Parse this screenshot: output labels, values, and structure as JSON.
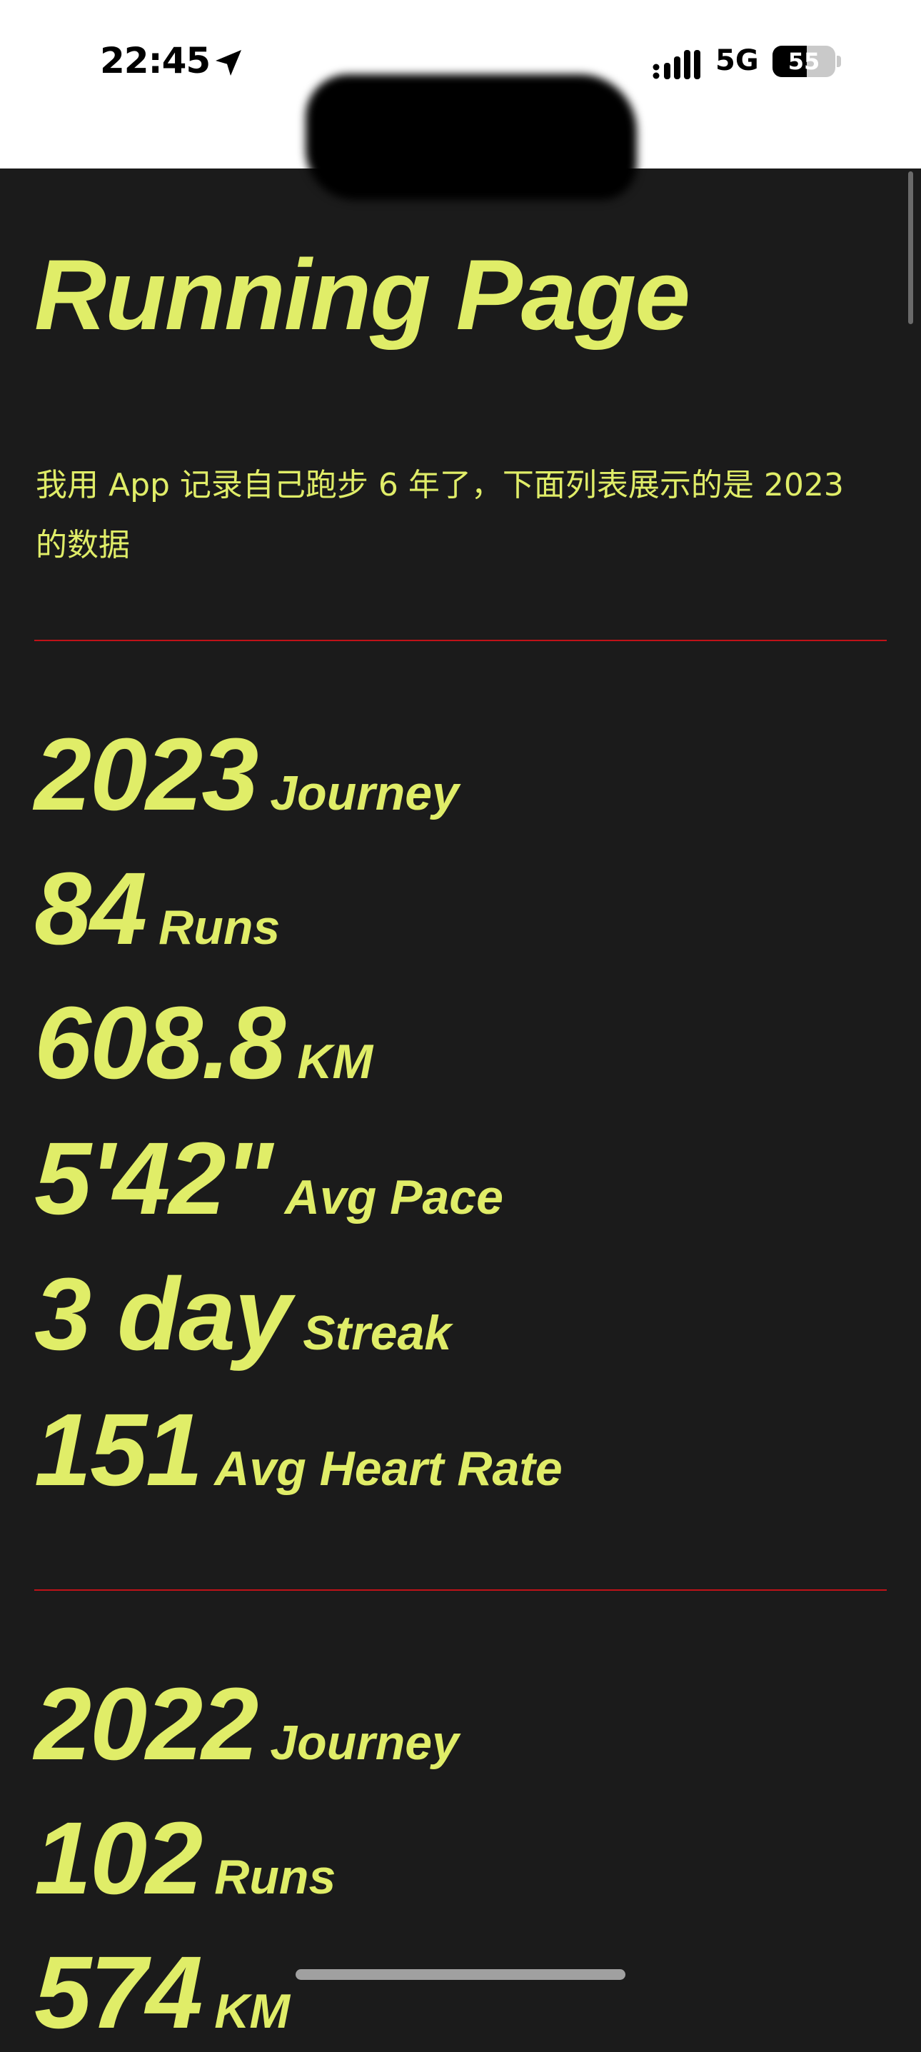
{
  "status_bar": {
    "time": "22:45",
    "network": "5G",
    "battery_level": "55",
    "battery_fraction": 0.55
  },
  "page": {
    "title": "Running Page",
    "intro": "我用 App 记录自己跑步 6 年了，下面列表展示的是 2023 的数据"
  },
  "colors": {
    "accent": "#e0ed68",
    "background": "#1b1b1b",
    "divider": "#c01218"
  },
  "years": [
    {
      "stats": [
        {
          "value": "2023",
          "label": "Journey"
        },
        {
          "value": "84",
          "label": "Runs"
        },
        {
          "value": "608.8",
          "label": "KM"
        },
        {
          "value": "5'42\"",
          "label": "Avg Pace"
        },
        {
          "value": "3 day",
          "label": "Streak"
        },
        {
          "value": "151",
          "label": "Avg Heart Rate"
        }
      ]
    },
    {
      "stats": [
        {
          "value": "2022",
          "label": "Journey"
        },
        {
          "value": "102",
          "label": "Runs"
        },
        {
          "value": "574",
          "label": "KM"
        }
      ]
    }
  ]
}
